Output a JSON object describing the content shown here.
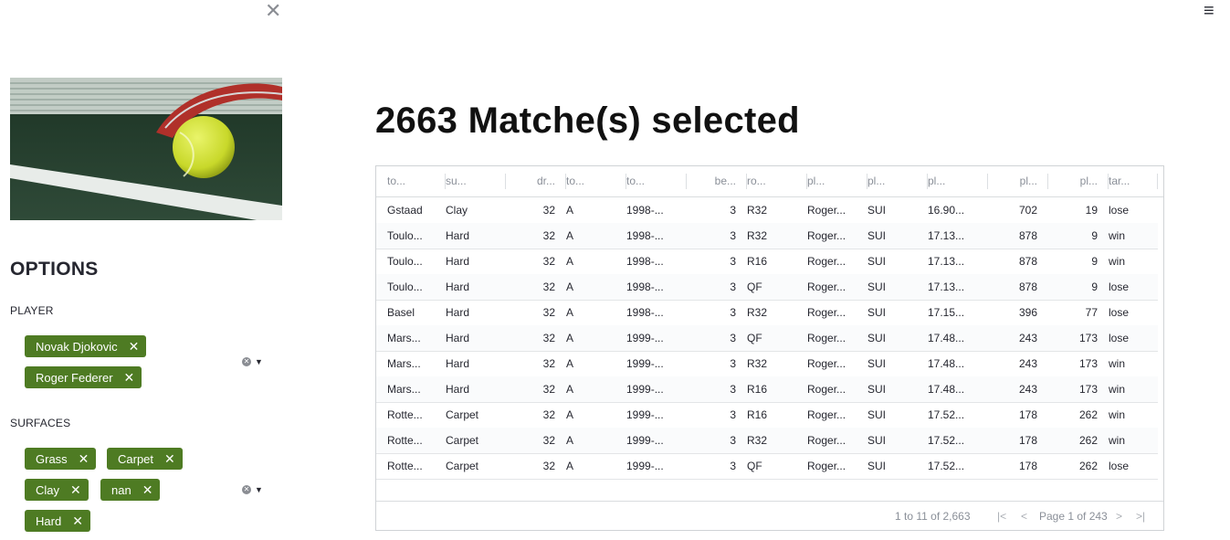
{
  "sidebar": {
    "close_glyph": "✕",
    "options_title": "OPTIONS",
    "player_label": "PLAYER",
    "players": [
      "Novak Djokovic",
      "Roger Federer"
    ],
    "surfaces_label": "SURFACES",
    "surfaces": [
      "Grass",
      "Carpet",
      "Clay",
      "nan",
      "Hard"
    ],
    "tag_color": "#4e7b23"
  },
  "menu_glyph": "≡",
  "main": {
    "heading": "2663 Matche(s) selected"
  },
  "grid": {
    "headers": [
      "to...",
      "su...",
      "dr...",
      "to...",
      "to...",
      "be...",
      "ro...",
      "pl...",
      "pl...",
      "pl...",
      "pl...",
      "pl...",
      "tar..."
    ],
    "rows": [
      [
        "Gstaad",
        "Clay",
        "32",
        "A",
        "1998-...",
        "3",
        "R32",
        "Roger...",
        "SUI",
        "16.90...",
        "702",
        "19",
        "lose"
      ],
      [
        "Toulo...",
        "Hard",
        "32",
        "A",
        "1998-...",
        "3",
        "R32",
        "Roger...",
        "SUI",
        "17.13...",
        "878",
        "9",
        "win"
      ],
      [
        "Toulo...",
        "Hard",
        "32",
        "A",
        "1998-...",
        "3",
        "R16",
        "Roger...",
        "SUI",
        "17.13...",
        "878",
        "9",
        "win"
      ],
      [
        "Toulo...",
        "Hard",
        "32",
        "A",
        "1998-...",
        "3",
        "QF",
        "Roger...",
        "SUI",
        "17.13...",
        "878",
        "9",
        "lose"
      ],
      [
        "Basel",
        "Hard",
        "32",
        "A",
        "1998-...",
        "3",
        "R32",
        "Roger...",
        "SUI",
        "17.15...",
        "396",
        "77",
        "lose"
      ],
      [
        "Mars...",
        "Hard",
        "32",
        "A",
        "1999-...",
        "3",
        "QF",
        "Roger...",
        "SUI",
        "17.48...",
        "243",
        "173",
        "lose"
      ],
      [
        "Mars...",
        "Hard",
        "32",
        "A",
        "1999-...",
        "3",
        "R32",
        "Roger...",
        "SUI",
        "17.48...",
        "243",
        "173",
        "win"
      ],
      [
        "Mars...",
        "Hard",
        "32",
        "A",
        "1999-...",
        "3",
        "R16",
        "Roger...",
        "SUI",
        "17.48...",
        "243",
        "173",
        "win"
      ],
      [
        "Rotte...",
        "Carpet",
        "32",
        "A",
        "1999-...",
        "3",
        "R16",
        "Roger...",
        "SUI",
        "17.52...",
        "178",
        "262",
        "win"
      ],
      [
        "Rotte...",
        "Carpet",
        "32",
        "A",
        "1999-...",
        "3",
        "R32",
        "Roger...",
        "SUI",
        "17.52...",
        "178",
        "262",
        "win"
      ],
      [
        "Rotte...",
        "Carpet",
        "32",
        "A",
        "1999-...",
        "3",
        "QF",
        "Roger...",
        "SUI",
        "17.52...",
        "178",
        "262",
        "lose"
      ]
    ],
    "footer_count": "1 to 11 of 2,663",
    "footer_page": "Page 1 of 243",
    "nav_first": "|<",
    "nav_prev": "<",
    "nav_next": ">",
    "nav_last": ">|"
  }
}
